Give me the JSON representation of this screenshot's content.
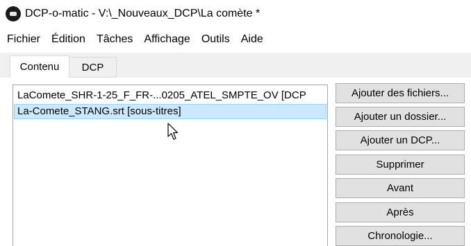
{
  "window": {
    "title": "DCP-o-matic - V:\\_Nouveaux_DCP\\La comète *",
    "icon": "dcp-o-matic-app-icon"
  },
  "menu": [
    "Fichier",
    "Édition",
    "Tâches",
    "Affichage",
    "Outils",
    "Aide"
  ],
  "tabs": [
    {
      "label": "Contenu",
      "active": true
    },
    {
      "label": "DCP",
      "active": false
    }
  ],
  "content_list": [
    {
      "label": "LaComete_SHR-1-25_F_FR-...0205_ATEL_SMPTE_OV [DCP",
      "selected": false
    },
    {
      "label": "La-Comete_STANG.srt [sous-titres]",
      "selected": true
    }
  ],
  "buttons": [
    "Ajouter des fichiers...",
    "Ajouter un dossier...",
    "Ajouter un DCP...",
    "Supprimer",
    "Avant",
    "Après",
    "Chronologie..."
  ],
  "colors": {
    "selection_bg": "#cce8ff",
    "selection_border": "#99d1ff",
    "button_bg": "#e1e1e1",
    "tab_strip_bg": "#f0f0f0"
  }
}
